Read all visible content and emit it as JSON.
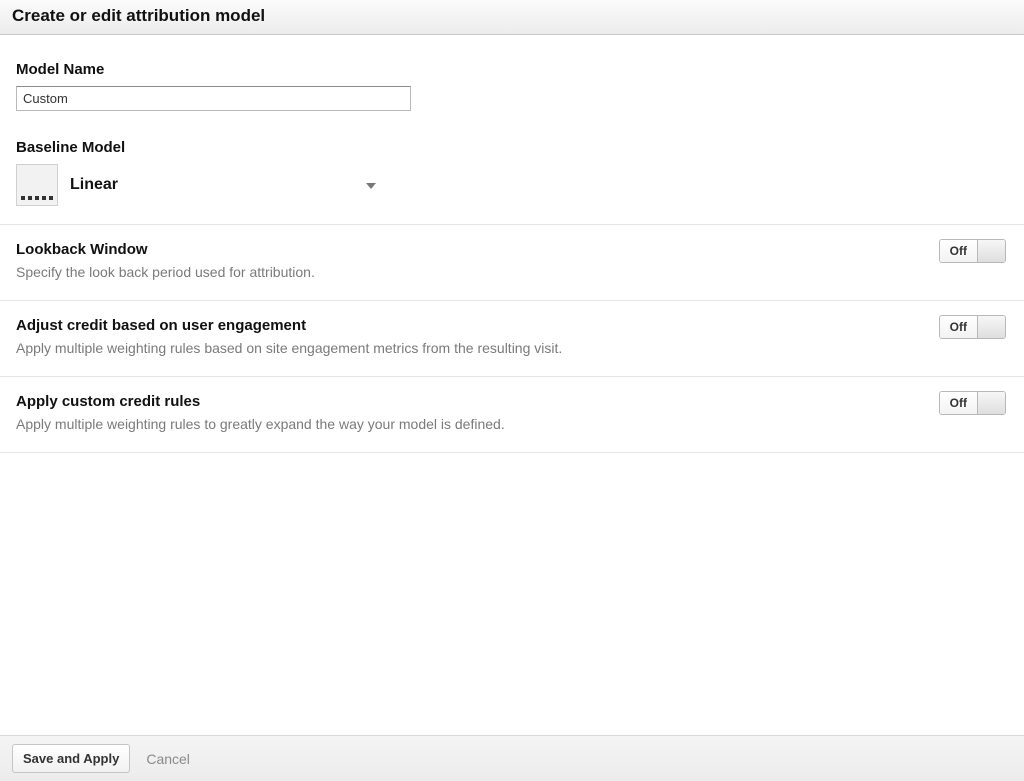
{
  "header": {
    "title": "Create or edit attribution model"
  },
  "model_name": {
    "label": "Model Name",
    "value": "Custom"
  },
  "baseline": {
    "label": "Baseline Model",
    "selected": "Linear"
  },
  "options": [
    {
      "title": "Lookback Window",
      "desc": "Specify the look back period used for attribution.",
      "toggle": "Off"
    },
    {
      "title": "Adjust credit based on user engagement",
      "desc": "Apply multiple weighting rules based on site engagement metrics from the resulting visit.",
      "toggle": "Off"
    },
    {
      "title": "Apply custom credit rules",
      "desc": "Apply multiple weighting rules to greatly expand the way your model is defined.",
      "toggle": "Off"
    }
  ],
  "footer": {
    "save": "Save and Apply",
    "cancel": "Cancel"
  }
}
